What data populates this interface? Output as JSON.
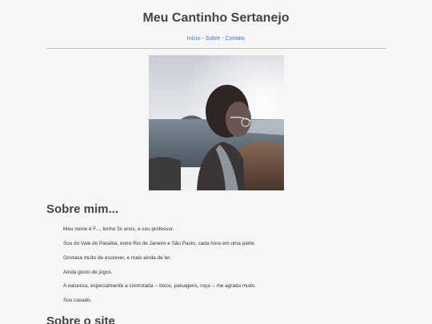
{
  "header": {
    "title": "Meu Cantinho Sertanejo",
    "nav": {
      "home": "Início",
      "about": "Sobre",
      "contact": "Contato",
      "separator": " - "
    }
  },
  "about": {
    "title": "Sobre mim...",
    "paragraphs": [
      "Meu nome é F..., tenho 3x anos, e sou professor.",
      "Sou do Vale do Paraíba, entre Rio de Janeiro e São Paulo, cada hora em uma parte.",
      "Gostava muito de escrever, e mais ainda de ler.",
      "Ainda gosto de jogos.",
      "A natureza, especialmente a controlada -- bixos, paisagens, roça -- me agrada muito.",
      "Sou casado."
    ]
  },
  "site_section": {
    "title": "Sobre o site"
  },
  "colors": {
    "background": "#f6f6f6",
    "link": "#2a7ad6",
    "heading": "#444444"
  }
}
